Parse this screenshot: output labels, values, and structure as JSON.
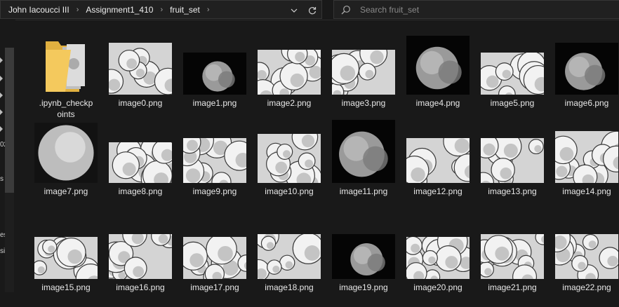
{
  "breadcrumb": [
    "John Iacoucci III",
    "Assignment1_410",
    "fruit_set"
  ],
  "search": {
    "placeholder": "Search fruit_set"
  },
  "nav_fragments": [
    "02",
    "s",
    "es",
    "si"
  ],
  "items": [
    {
      "name": ".ipynb_checkpoints",
      "type": "folder"
    },
    {
      "name": "image0.png",
      "type": "image"
    },
    {
      "name": "image1.png",
      "type": "image"
    },
    {
      "name": "image2.png",
      "type": "image"
    },
    {
      "name": "image3.png",
      "type": "image"
    },
    {
      "name": "image4.png",
      "type": "image"
    },
    {
      "name": "image5.png",
      "type": "image"
    },
    {
      "name": "image6.png",
      "type": "image"
    },
    {
      "name": "image7.png",
      "type": "image"
    },
    {
      "name": "image8.png",
      "type": "image"
    },
    {
      "name": "image9.png",
      "type": "image"
    },
    {
      "name": "image10.png",
      "type": "image"
    },
    {
      "name": "image11.png",
      "type": "image"
    },
    {
      "name": "image12.png",
      "type": "image"
    },
    {
      "name": "image13.png",
      "type": "image"
    },
    {
      "name": "image14.png",
      "type": "image"
    },
    {
      "name": "image15.png",
      "type": "image"
    },
    {
      "name": "image16.png",
      "type": "image"
    },
    {
      "name": "image17.png",
      "type": "image"
    },
    {
      "name": "image18.png",
      "type": "image"
    },
    {
      "name": "image19.png",
      "type": "image"
    },
    {
      "name": "image20.png",
      "type": "image"
    },
    {
      "name": "image21.png",
      "type": "image"
    },
    {
      "name": "image22.png",
      "type": "image"
    }
  ],
  "colors": {
    "background": "#191919",
    "folder": "#f4c95d",
    "text": "#e8e8e8"
  }
}
